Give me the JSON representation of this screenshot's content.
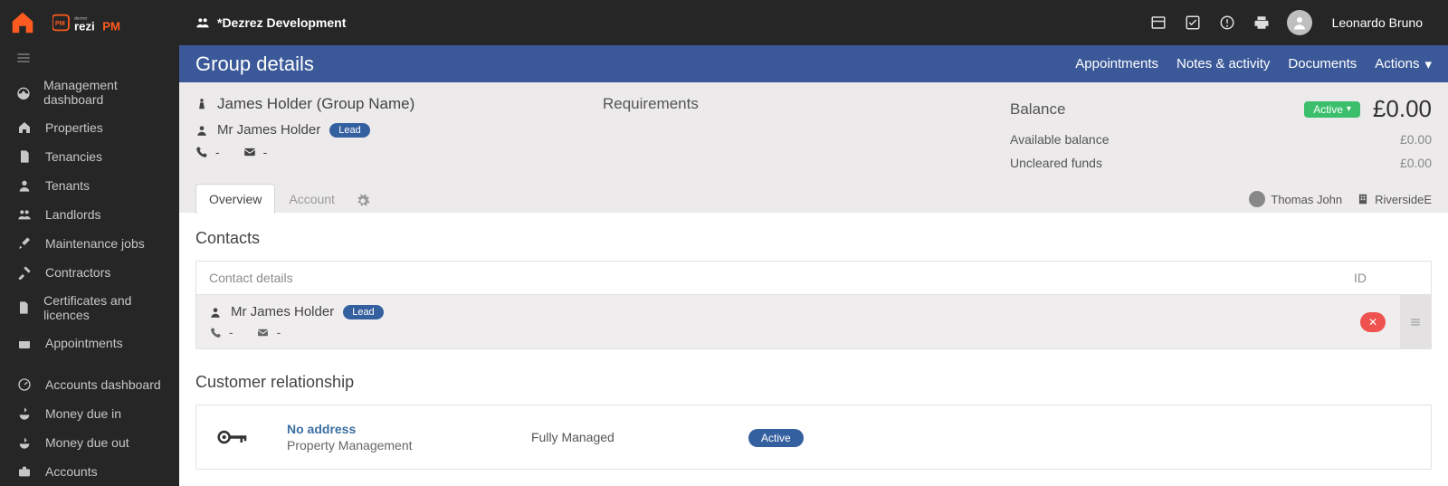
{
  "topbar": {
    "workspace": "*Dezrez Development",
    "username": "Leonardo Bruno"
  },
  "sidebar": {
    "items": [
      {
        "label": "Management dashboard"
      },
      {
        "label": "Properties"
      },
      {
        "label": "Tenancies"
      },
      {
        "label": "Tenants"
      },
      {
        "label": "Landlords"
      },
      {
        "label": "Maintenance jobs"
      },
      {
        "label": "Contractors"
      },
      {
        "label": "Certificates and licences"
      },
      {
        "label": "Appointments"
      }
    ],
    "group2": [
      {
        "label": "Accounts dashboard"
      },
      {
        "label": "Money due in"
      },
      {
        "label": "Money due out"
      },
      {
        "label": "Accounts"
      }
    ]
  },
  "bluebar": {
    "title": "Group details",
    "tabs": [
      "Appointments",
      "Notes & activity",
      "Documents",
      "Actions"
    ]
  },
  "summary": {
    "group_name": "James Holder (Group Name)",
    "person_name": "Mr James Holder",
    "lead_pill": "Lead",
    "phone": "-",
    "email": "-",
    "requirements_title": "Requirements",
    "balance_title": "Balance",
    "status": "Active",
    "balance_amount": "£0.00",
    "subs": [
      {
        "label": "Available balance",
        "value": "£0.00"
      },
      {
        "label": "Uncleared funds",
        "value": "£0.00"
      }
    ]
  },
  "subtabs": [
    "Overview",
    "Account"
  ],
  "meta": {
    "owner": "Thomas John",
    "branch": "RiversideE"
  },
  "contacts": {
    "heading": "Contacts",
    "col_details": "Contact details",
    "col_id": "ID",
    "rows": [
      {
        "name": "Mr James Holder",
        "lead": "Lead",
        "phone": "-",
        "email": "-",
        "id_action": "✕"
      }
    ]
  },
  "relationship": {
    "heading": "Customer relationship",
    "no_addr": "No address",
    "pm": "Property Management",
    "service": "Fully Managed",
    "status": "Active"
  }
}
